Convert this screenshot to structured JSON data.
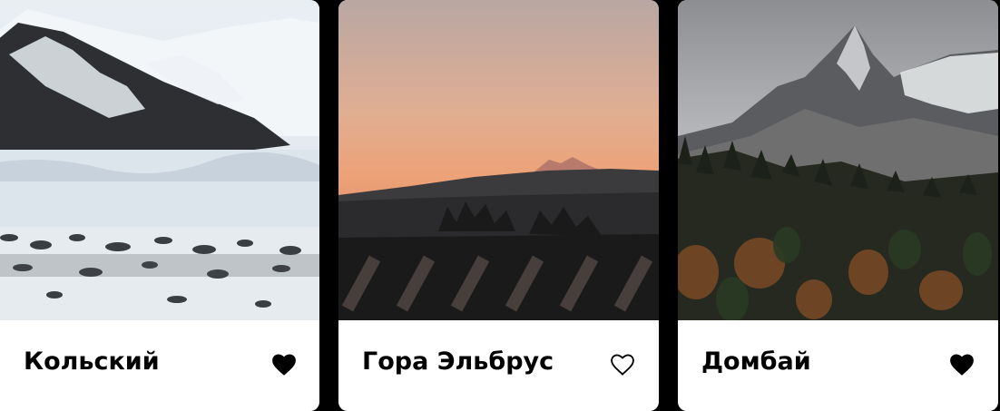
{
  "cards": [
    {
      "title": "Кольский",
      "liked": true,
      "image": "snowy-mountain-coast-photo",
      "icon": "heart-filled-icon"
    },
    {
      "title": "Гора Эльбрус",
      "liked": false,
      "image": "sunset-mountain-silhouette-photo",
      "icon": "heart-outline-icon"
    },
    {
      "title": "Домбай",
      "liked": true,
      "image": "mountain-peak-forest-photo",
      "icon": "heart-filled-icon"
    }
  ],
  "colors": {
    "background": "#000000",
    "card": "#ffffff",
    "text": "#000000"
  }
}
